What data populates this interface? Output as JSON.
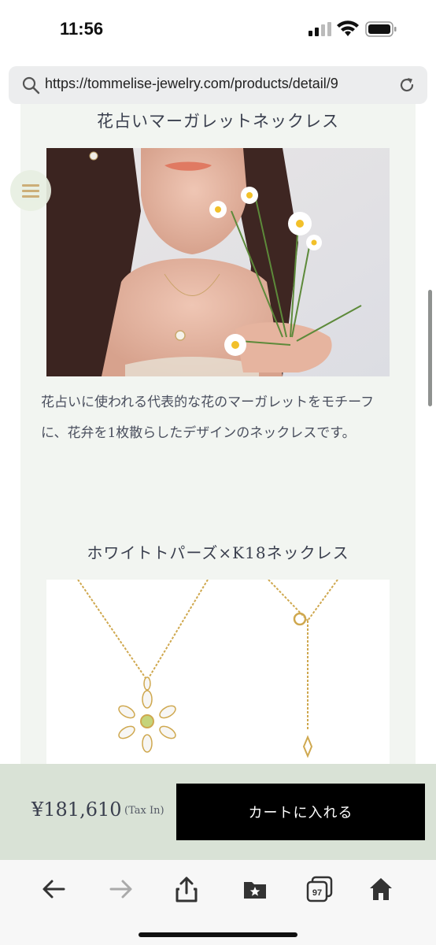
{
  "status": {
    "time": "11:56"
  },
  "browser": {
    "url": "https://tommelise-jewelry.com/products/detail/9",
    "tab_count": "97"
  },
  "page": {
    "section1_title": "花占いマーガレットネックレス",
    "section1_desc": "花占いに使われる代表的な花のマーガレットをモチーフに、花弁を1枚散らしたデザインのネックレスです。",
    "section2_title": "ホワイトトパーズ×K18ネックレス"
  },
  "cart": {
    "price": "¥181,610",
    "tax_label": "(Tax In)",
    "add_to_cart": "カートに入れる"
  },
  "colors": {
    "panel": "#f2f5f1",
    "cart_bar": "#d9e2d6",
    "accent_gold": "#c9a96e"
  },
  "icons": [
    "search-icon",
    "reload-icon",
    "menu-icon",
    "back-icon",
    "forward-icon",
    "share-icon",
    "bookmarks-icon",
    "tabs-icon",
    "home-icon"
  ]
}
